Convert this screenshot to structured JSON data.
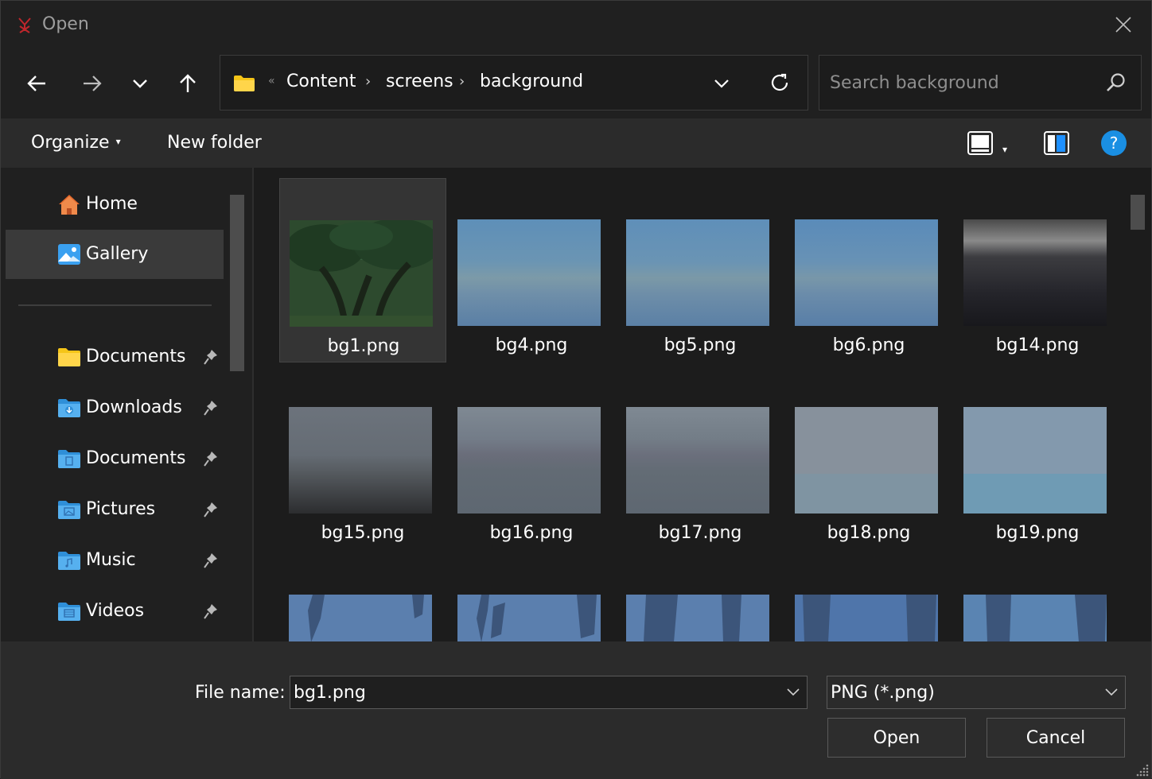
{
  "window": {
    "title": "Open"
  },
  "address": {
    "breadcrumbs": [
      "Content",
      "screens",
      "background"
    ]
  },
  "search": {
    "placeholder": "Search background"
  },
  "toolbar": {
    "organize_label": "Organize",
    "new_folder_label": "New folder"
  },
  "sidebar": {
    "items": [
      {
        "label": "Home",
        "icon": "home-icon"
      },
      {
        "label": "Gallery",
        "icon": "gallery-icon",
        "selected": true
      },
      {
        "label": "Documents",
        "icon": "folder-icon",
        "pinned": true
      },
      {
        "label": "Downloads",
        "icon": "downloads-folder-icon",
        "pinned": true
      },
      {
        "label": "Documents",
        "icon": "documents-folder-icon",
        "pinned": true
      },
      {
        "label": "Pictures",
        "icon": "pictures-folder-icon",
        "pinned": true
      },
      {
        "label": "Music",
        "icon": "music-folder-icon",
        "pinned": true
      },
      {
        "label": "Videos",
        "icon": "videos-folder-icon",
        "pinned": true
      }
    ]
  },
  "files": [
    {
      "name": "bg1.png",
      "selected": true
    },
    {
      "name": "bg4.png"
    },
    {
      "name": "bg5.png"
    },
    {
      "name": "bg6.png"
    },
    {
      "name": "bg14.png"
    },
    {
      "name": "bg15.png"
    },
    {
      "name": "bg16.png"
    },
    {
      "name": "bg17.png"
    },
    {
      "name": "bg18.png"
    },
    {
      "name": "bg19.png"
    }
  ],
  "footer": {
    "file_name_label": "File name:",
    "file_name_value": "bg1.png",
    "file_type_value": "PNG (*.png)",
    "open_label": "Open",
    "cancel_label": "Cancel"
  },
  "colors": {
    "accent": "#0078d4",
    "folder": "#f5c518",
    "window_bg": "#1c1c1c"
  }
}
